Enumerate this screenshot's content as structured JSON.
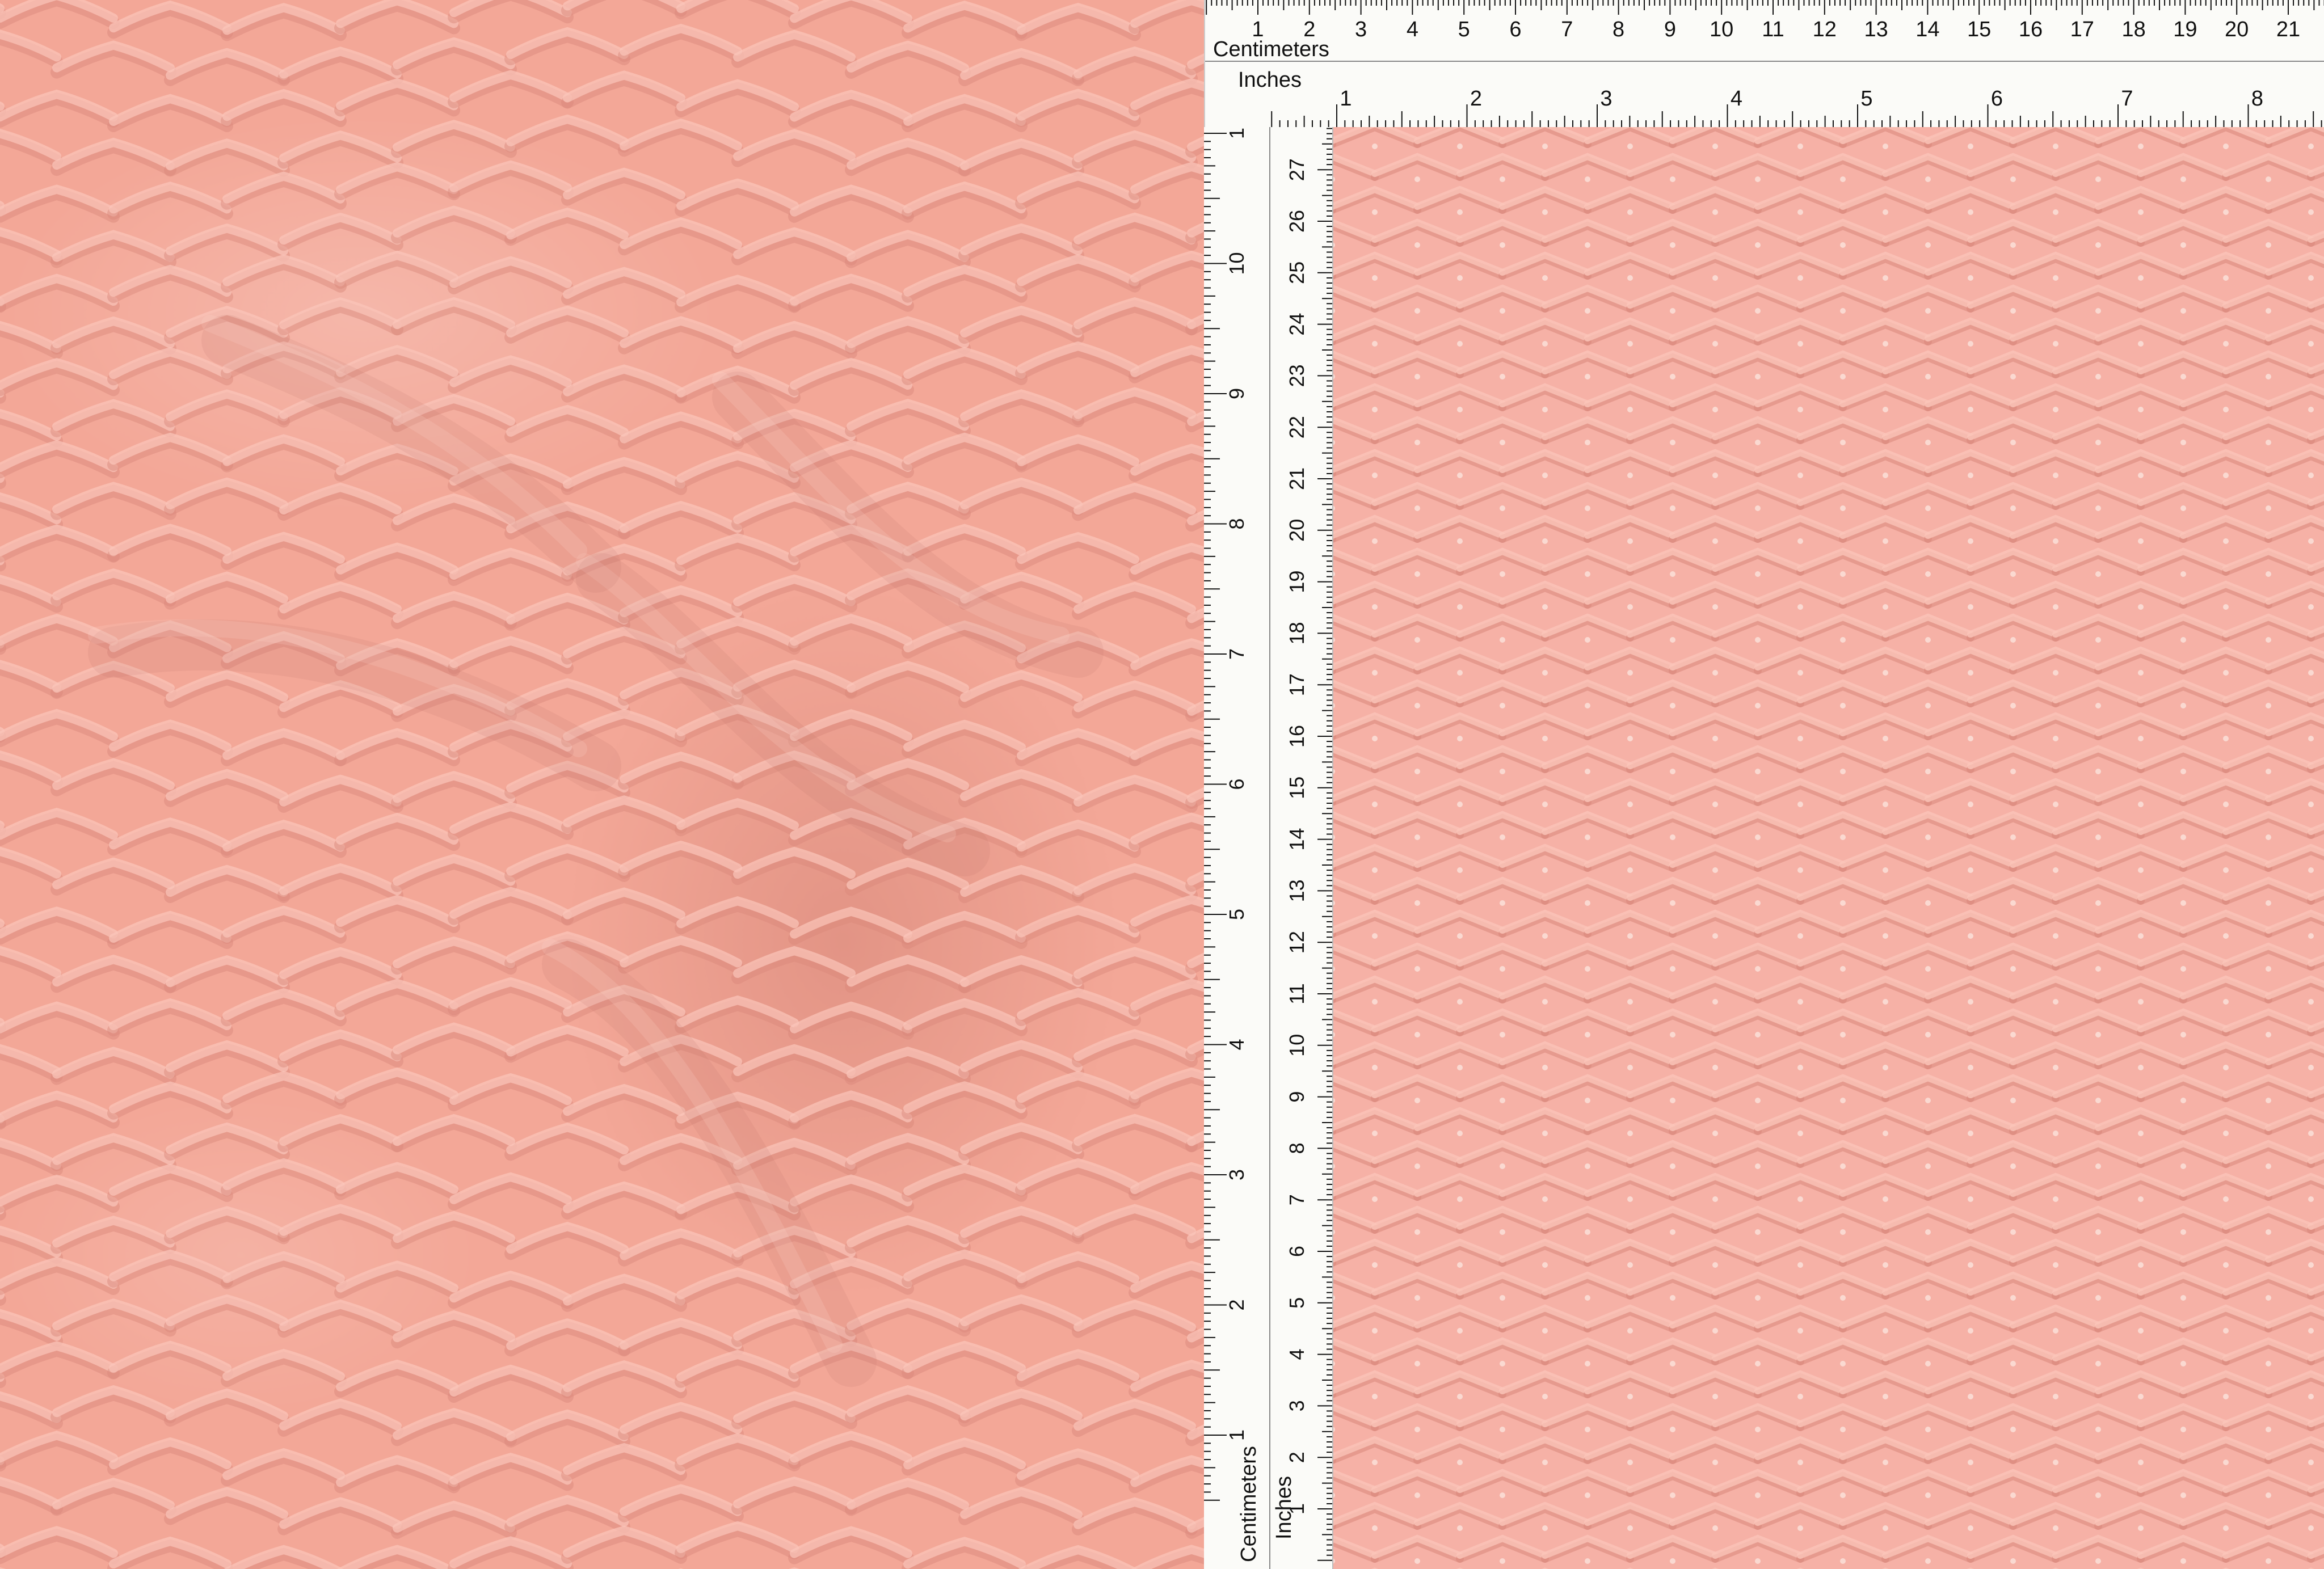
{
  "colors": {
    "fabric_base": "#f3a797",
    "fabric_flat": "#f6b1a6",
    "fabric_highlight": "#fbc6ba",
    "fabric_shadow": "#d9877a",
    "ruler_bg": "#fbfbf8",
    "ruler_ink": "#111111"
  },
  "ruler_top": {
    "cm_label": "Centimeters",
    "in_label": "Inches",
    "cm_numbers": [
      "1",
      "2",
      "3",
      "4",
      "5",
      "6",
      "7",
      "8",
      "9",
      "10",
      "11",
      "12",
      "13",
      "14",
      "15",
      "16",
      "17",
      "18",
      "19",
      "20",
      "21"
    ],
    "in_numbers": [
      "1",
      "2",
      "3",
      "4",
      "5",
      "6",
      "7",
      "8"
    ]
  },
  "ruler_left": {
    "cm_label": "Centimeters",
    "in_label": "Inches",
    "cm_numbers": [
      "1",
      "2",
      "3",
      "4",
      "5",
      "6",
      "7",
      "8",
      "9",
      "10",
      "11",
      "12",
      "13",
      "14",
      "15",
      "16",
      "17",
      "18",
      "19",
      "20",
      "21",
      "22",
      "23",
      "24",
      "25",
      "26",
      "27",
      "2"
    ],
    "in_numbers": [
      "1",
      "2",
      "3",
      "4",
      "5",
      "6",
      "7",
      "8",
      "9",
      "10",
      "1"
    ]
  }
}
